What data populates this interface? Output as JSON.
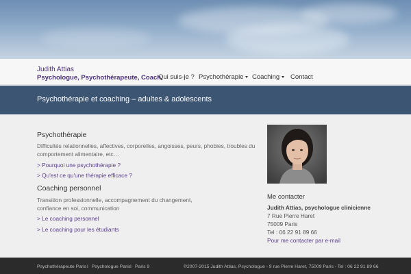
{
  "header": {
    "brand_name": "Judith Attias",
    "brand_tagline": "Psychologue, Psychothérapeute, Coach."
  },
  "nav": {
    "items": [
      {
        "label": "Qui suis-je ?"
      },
      {
        "label": "Psychothérapie"
      },
      {
        "label": "Coaching"
      },
      {
        "label": "Contact"
      }
    ]
  },
  "banner": {
    "title": "Psychothérapie et coaching – adultes & adolescents"
  },
  "sections": {
    "psychotherapie": {
      "heading": "Psychothérapie",
      "text_line1": "Difficultés relationnelles, affectives, corporelles, angoisses, peurs, phobies, troubles du",
      "text_line2": "comportement alimentaire, etc…",
      "links": [
        "> Pourquoi une psychothérapie ?",
        "> Qu'est ce qu'une thérapie efficace ?"
      ]
    },
    "coaching": {
      "heading": "Coaching personnel",
      "text_line1": "Transition professionnelle, accompagnement du changement,",
      "text_line2": "confiance en soi, communication",
      "links": [
        "> Le coaching personnel",
        "> Le coaching pour les étudiants"
      ]
    }
  },
  "contact": {
    "heading": "Me contacter",
    "name": "Judith Attias, psychologue clinicienne",
    "street": "7 Rue Pierre Haret",
    "city": "75009 Paris",
    "phone": "Tel : 06 22 91 89 66",
    "email_link": "Pour me contacter par e-mail"
  },
  "footer": {
    "links": [
      "Psychothérapeute Paris",
      "Psychologue Paris",
      "Paris 9"
    ],
    "separator": "I",
    "copyright": "©2007-2015 Judith Attias, Psychologue - 9 rue Pierre Haret, 75009 Paris - Tel : 06 22 91 89 66"
  },
  "colors": {
    "brand": "#4a2e78",
    "banner_bg": "#3c5573",
    "link": "#5b3e8c",
    "footer_bg": "#2b2b2b"
  }
}
